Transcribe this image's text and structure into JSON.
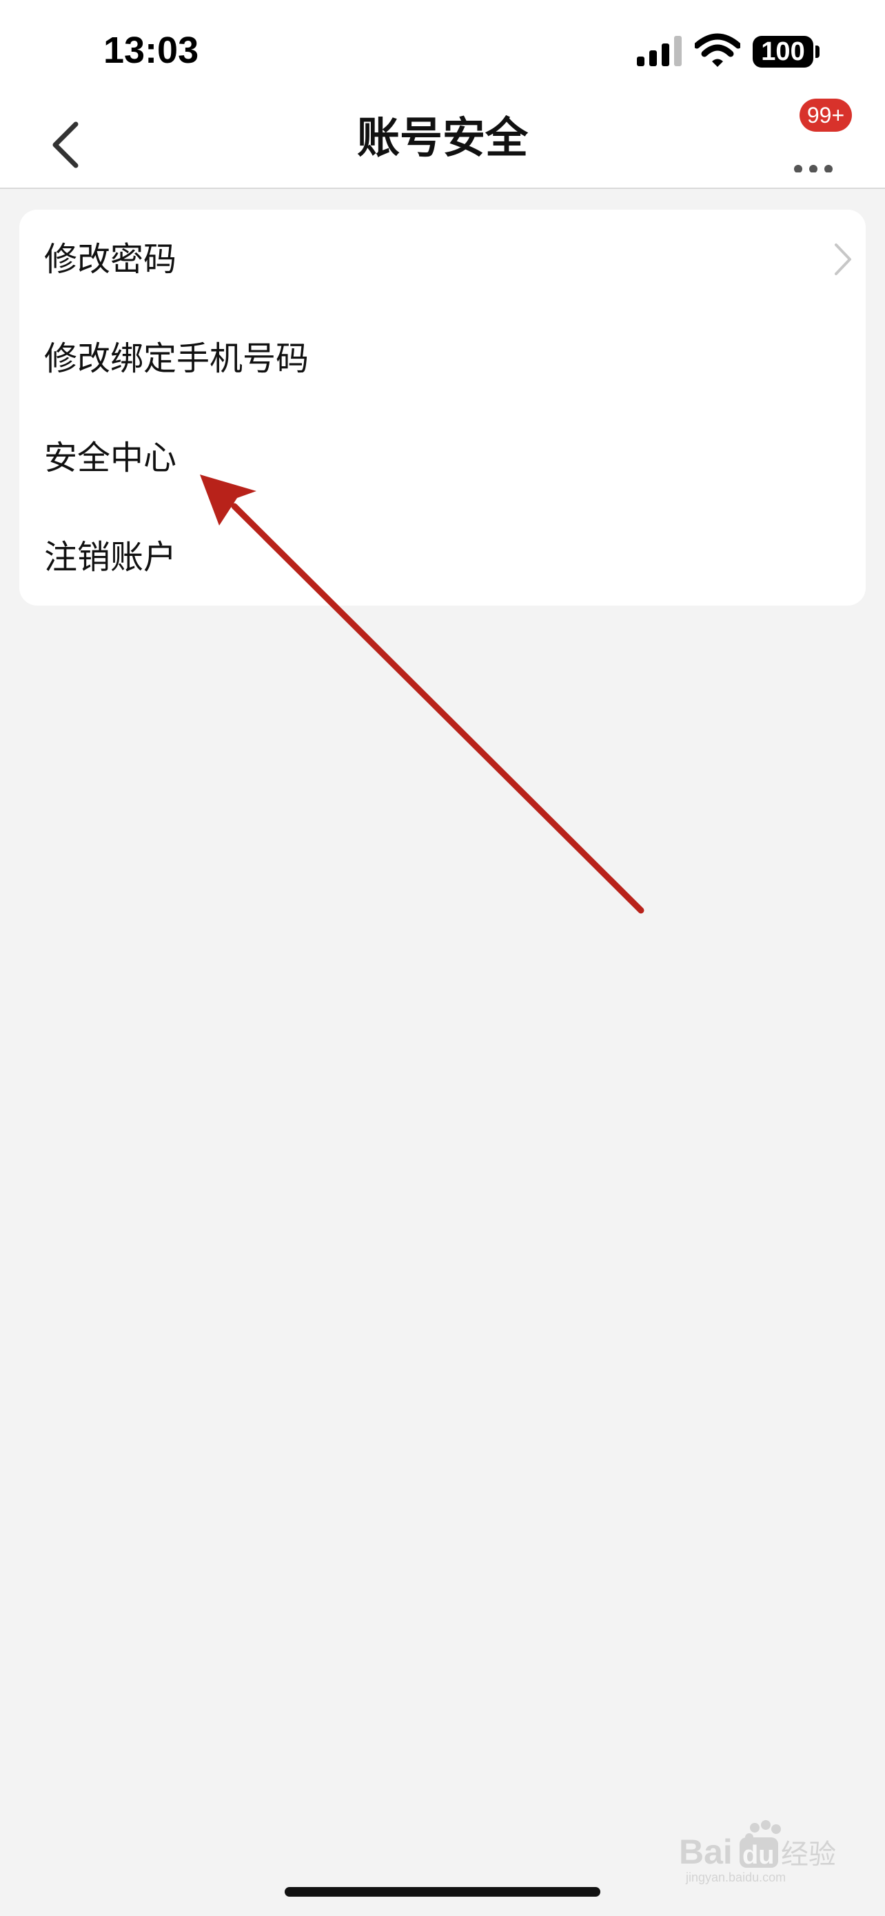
{
  "status_bar": {
    "time": "13:03",
    "battery": "100",
    "signal_icon": "cellular-signal-icon",
    "wifi_icon": "wifi-icon"
  },
  "nav": {
    "title": "账号安全",
    "back_icon": "chevron-left-icon",
    "more_icon": "more-dots-icon",
    "badge": "99+"
  },
  "menu": {
    "items": [
      {
        "label": "修改密码",
        "has_chevron": true
      },
      {
        "label": "修改绑定手机号码",
        "has_chevron": false
      },
      {
        "label": "安全中心",
        "has_chevron": false
      },
      {
        "label": "注销账户",
        "has_chevron": false
      }
    ]
  },
  "annotation": {
    "color": "#b8221a",
    "points_to": "安全中心"
  },
  "watermark": {
    "brand": "Baidu经验",
    "url": "jingyan.baidu.com"
  },
  "colors": {
    "background": "#f3f3f3",
    "card": "#ffffff",
    "badge": "#d8322b"
  }
}
